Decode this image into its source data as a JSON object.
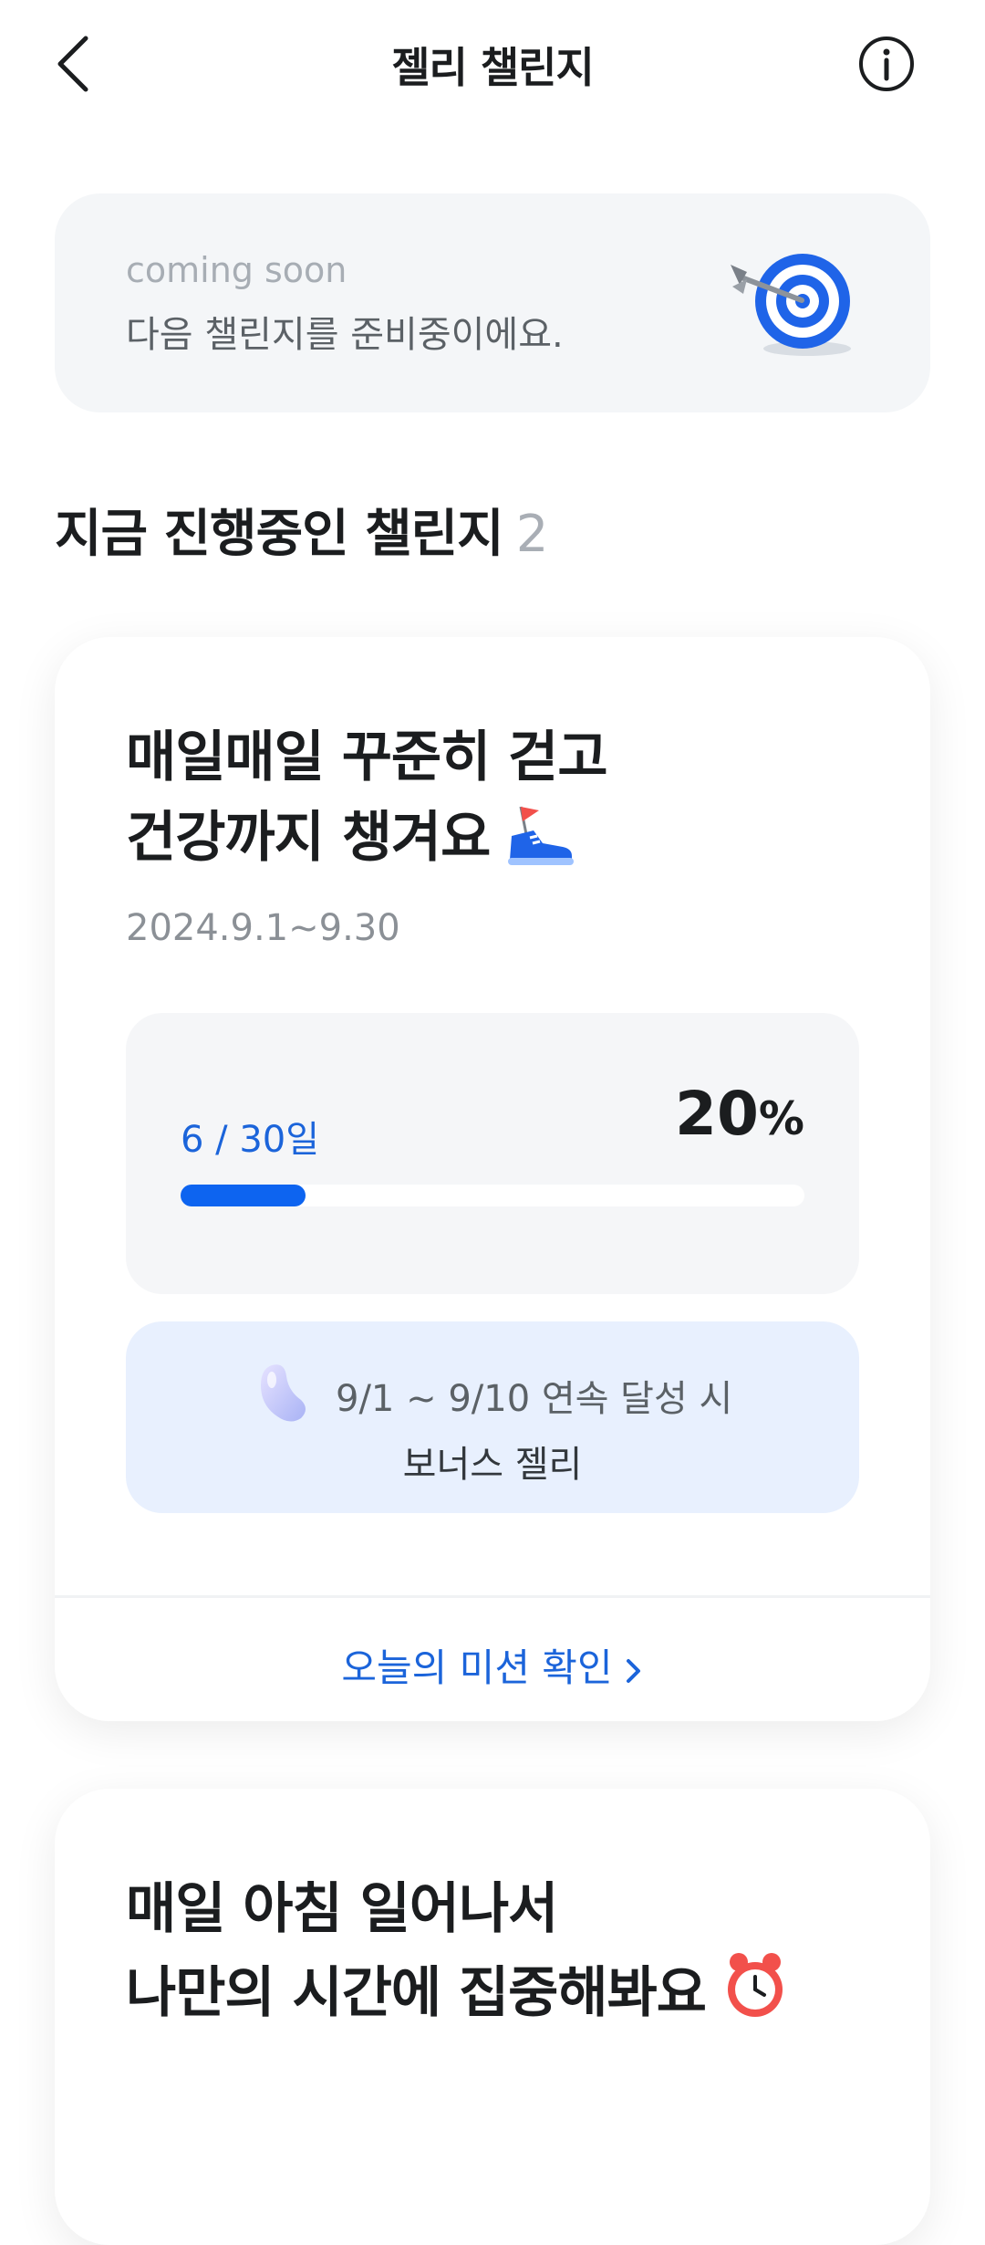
{
  "header": {
    "title": "젤리 챌린지"
  },
  "coming_soon": {
    "label_en": "coming soon",
    "label_ko": "다음 챌린지를 준비중이에요."
  },
  "section": {
    "title": "지금 진행중인 챌린지",
    "count": "2"
  },
  "challenges": [
    {
      "title_line1": "매일매일 꾸준히 걷고",
      "title_line2": "건강까지 챙겨요",
      "period": "2024.9.1~9.30",
      "progress": {
        "days": "6 / 30일",
        "percent_value": "20",
        "percent_unit": "%",
        "fraction": 0.2
      },
      "bonus": {
        "line1": "9/1 ~ 9/10 연속 달성 시",
        "line2": "보너스 젤리"
      },
      "mission_link": "오늘의 미션 확인"
    },
    {
      "title_line1": "매일 아침 일어나서",
      "title_line2": "나만의 시간에 집중해봐요"
    }
  ],
  "colors": {
    "accent": "#0d64f0",
    "link": "#1b64da",
    "bonus_bg": "#e8f0fe",
    "card_bg": "#f4f6f8"
  },
  "icons": [
    "back-arrow-icon",
    "info-icon",
    "dart-target-icon",
    "sneaker-icon",
    "jelly-bean-icon",
    "chevron-right-icon",
    "alarm-clock-icon"
  ]
}
